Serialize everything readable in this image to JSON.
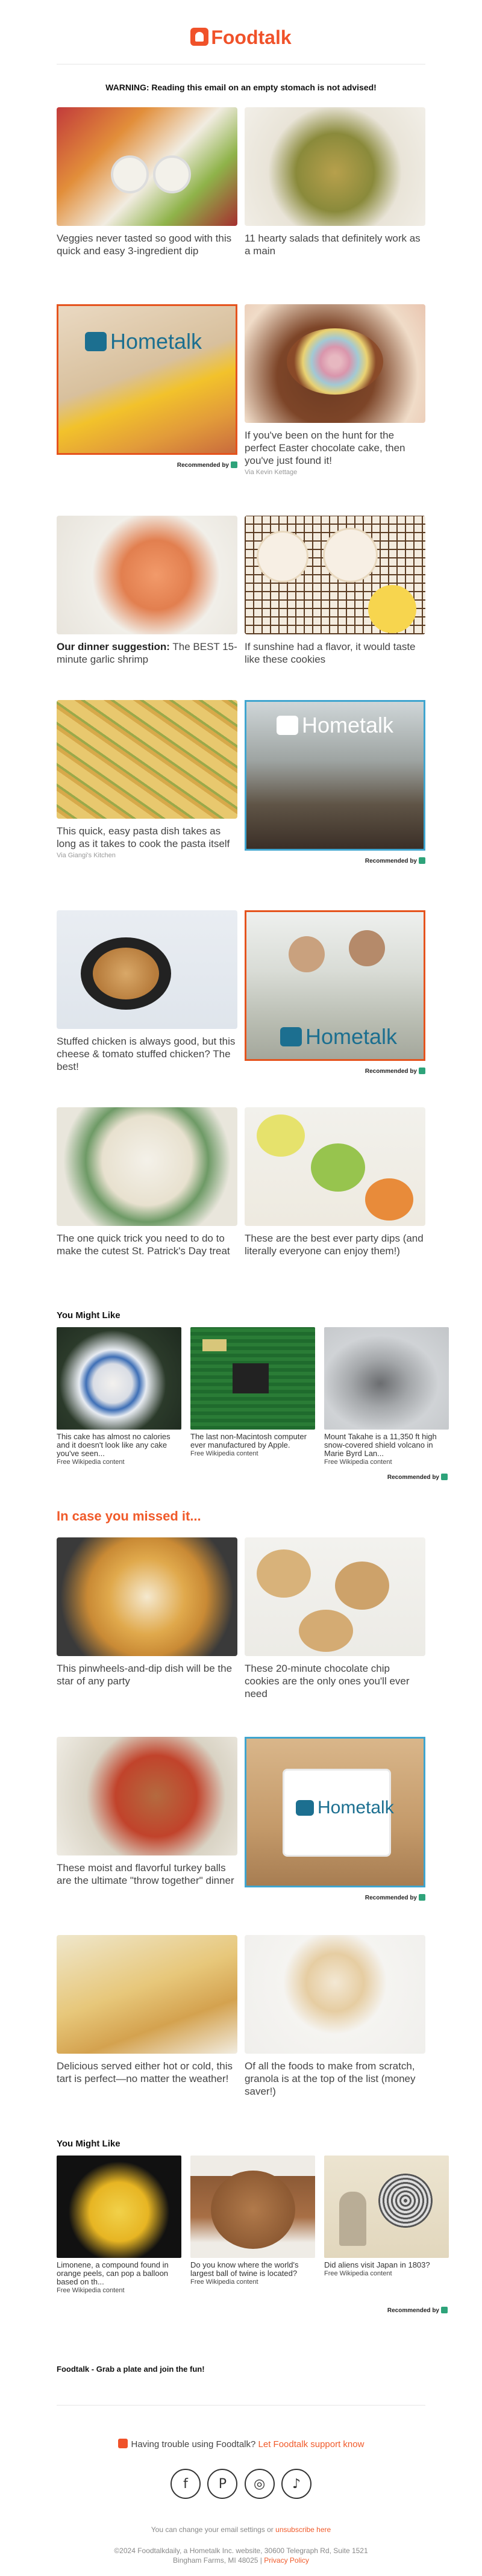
{
  "brand": {
    "name": "Foodtalk",
    "accent": "#f0522a"
  },
  "warning": "WARNING: Reading this email on an empty stomach is not advised!",
  "rows": [
    {
      "left": {
        "caption": "Veggies never tasted so good with this quick and easy 3-ingredient dip",
        "bold": ""
      },
      "right": {
        "caption": "11 hearty salads that definitely work as a main",
        "bold": ""
      }
    },
    {
      "left": {
        "ad": "Hometalk",
        "recommended": "Recommended by"
      },
      "right": {
        "caption": "If you've been on the hunt for the perfect Easter chocolate cake, then you've just found it!",
        "via": "Via Kevin Kettage"
      }
    },
    {
      "left": {
        "bold": "Our dinner suggestion:",
        "caption": " The BEST 15-minute garlic shrimp"
      },
      "right": {
        "caption": "If sunshine had a flavor, it would taste like these cookies"
      }
    },
    {
      "left": {
        "caption": "This quick, easy pasta dish takes as long as it takes to cook the pasta itself",
        "via": "Via Giangi's Kitchen"
      },
      "right": {
        "ad": "Hometalk",
        "recommended": "Recommended by"
      }
    },
    {
      "left": {
        "caption": "Stuffed chicken is always good, but this cheese & tomato stuffed chicken? The best!"
      },
      "right": {
        "ad": "Hometalk",
        "recommended": "Recommended by"
      }
    },
    {
      "left": {
        "caption": "The one quick trick you need to do to make the cutest St. Patrick's Day treat"
      },
      "right": {
        "caption": "These are the best ever party dips (and literally everyone can enjoy them!)"
      }
    }
  ],
  "you_might_like_1": {
    "title": "You Might Like",
    "items": [
      {
        "title": "This cake has almost no calories and it doesn't look like any cake you've seen...",
        "source": "Free Wikipedia content"
      },
      {
        "title": "The last non-Macintosh computer ever manufactured by Apple.",
        "source": "Free Wikipedia content"
      },
      {
        "title": "Mount Takahe is a 11,350 ft high snow-covered shield volcano in Marie Byrd Lan...",
        "source": "Free Wikipedia content"
      }
    ],
    "recommended": "Recommended by"
  },
  "missed": {
    "title": "In case you missed it...",
    "rows": [
      {
        "left": {
          "caption": "This pinwheels-and-dip dish will be the star of any party"
        },
        "right": {
          "caption": "These 20-minute chocolate chip cookies are the only ones you'll ever need"
        }
      },
      {
        "left": {
          "caption": "These moist and flavorful turkey balls are the ultimate \"throw together\" dinner"
        },
        "right": {
          "ad": "Hometalk",
          "recommended": "Recommended by"
        }
      },
      {
        "left": {
          "caption": "Delicious served either hot or cold, this tart is perfect—no matter the weather!"
        },
        "right": {
          "caption": "Of all the foods to make from scratch, granola is at the top of the list (money saver!)"
        }
      }
    ]
  },
  "you_might_like_2": {
    "title": "You Might Like",
    "items": [
      {
        "title": "Limonene, a compound found in orange peels, can pop a balloon based on th...",
        "source": "Free Wikipedia content"
      },
      {
        "title": "Do you know where the world's largest ball of twine is located?",
        "source": "Free Wikipedia content"
      },
      {
        "title": "Did aliens visit Japan in 1803?",
        "source": "Free Wikipedia content"
      }
    ],
    "recommended": "Recommended by"
  },
  "footer": {
    "tagline": "Foodtalk - Grab a plate and join the fun!",
    "support_text": "Having trouble using Foodtalk?",
    "support_link": "Let Foodtalk support know",
    "socials": [
      "f",
      "P",
      "◎",
      "♪"
    ],
    "settings_text": "You can change your email settings or",
    "unsubscribe": "unsubscribe here",
    "copyright": "©2024 Foodtalkdaily, a Hometalk Inc. website, 30600 Telegraph Rd, Suite 1521",
    "address": "Bingham Farms, MI 48025",
    "privacy": "Privacy Policy"
  }
}
